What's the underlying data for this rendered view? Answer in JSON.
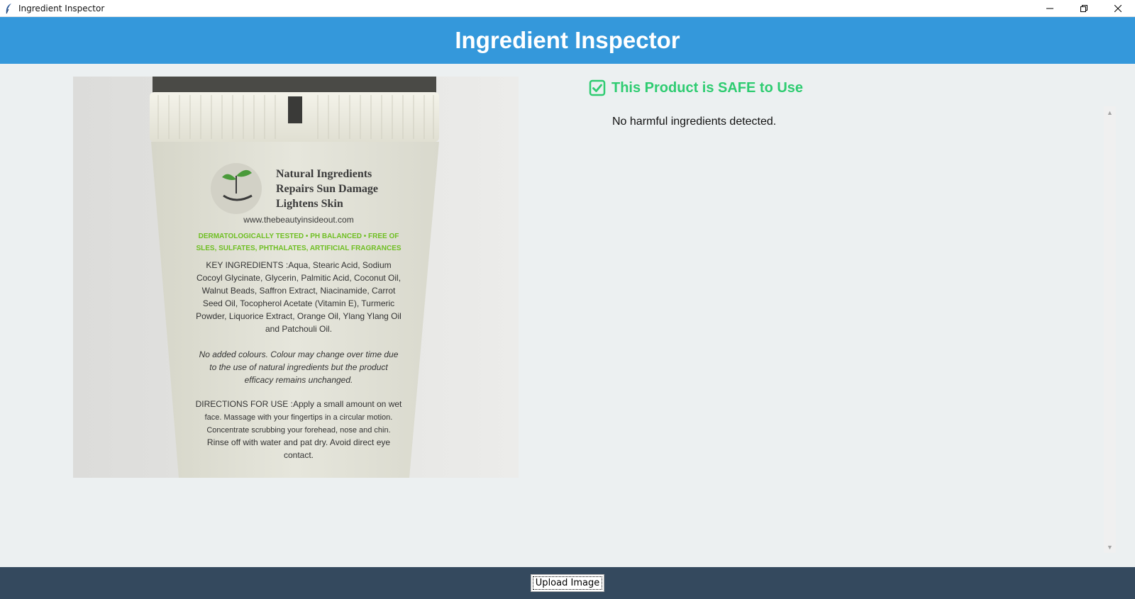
{
  "window": {
    "title": "Ingredient Inspector",
    "controls": [
      "minimize",
      "restore",
      "close"
    ]
  },
  "header": {
    "title": "Ingredient Inspector",
    "background": "#3498db"
  },
  "product_image": {
    "label_lines": [
      "Natural Ingredients",
      "Repairs Sun Damage",
      "Lightens Skin",
      "www.thebeautyinsideout.com",
      "DERMATOLOGICALLY TESTED • PH BALANCED • FREE OF",
      "SLES, SULFATES, PHTHALATES, ARTIFICIAL FRAGRANCES",
      "KEY INGREDIENTS :Aqua, Stearic Acid, Sodium",
      "Cocoyl Glycinate, Glycerin, Palmitic Acid, Coconut Oil,",
      "Walnut Beads, Saffron Extract, Niacinamide, Carrot",
      "Seed Oil, Tocopherol Acetate (Vitamin E), Turmeric",
      "Powder, Liquorice Extract, Orange Oil, Ylang Ylang Oil",
      "and Patchouli Oil.",
      "No added colours. Colour may change over time due",
      "to the use of natural ingredients but the product",
      "efficacy remains unchanged.",
      "DIRECTIONS FOR USE :Apply a small amount on wet",
      "face. Massage with your fingertips in a circular motion.",
      "Concentrate scrubbing your forehead, nose and chin.",
      "Rinse off with water and pat dry. Avoid direct eye",
      "contact."
    ]
  },
  "result": {
    "status_icon": "check-box-icon",
    "status_text": "This Product is SAFE to Use",
    "status_color": "#2ecc71",
    "message": "No harmful ingredients detected."
  },
  "footer": {
    "upload_label": "Upload Image",
    "background": "#34495e"
  }
}
